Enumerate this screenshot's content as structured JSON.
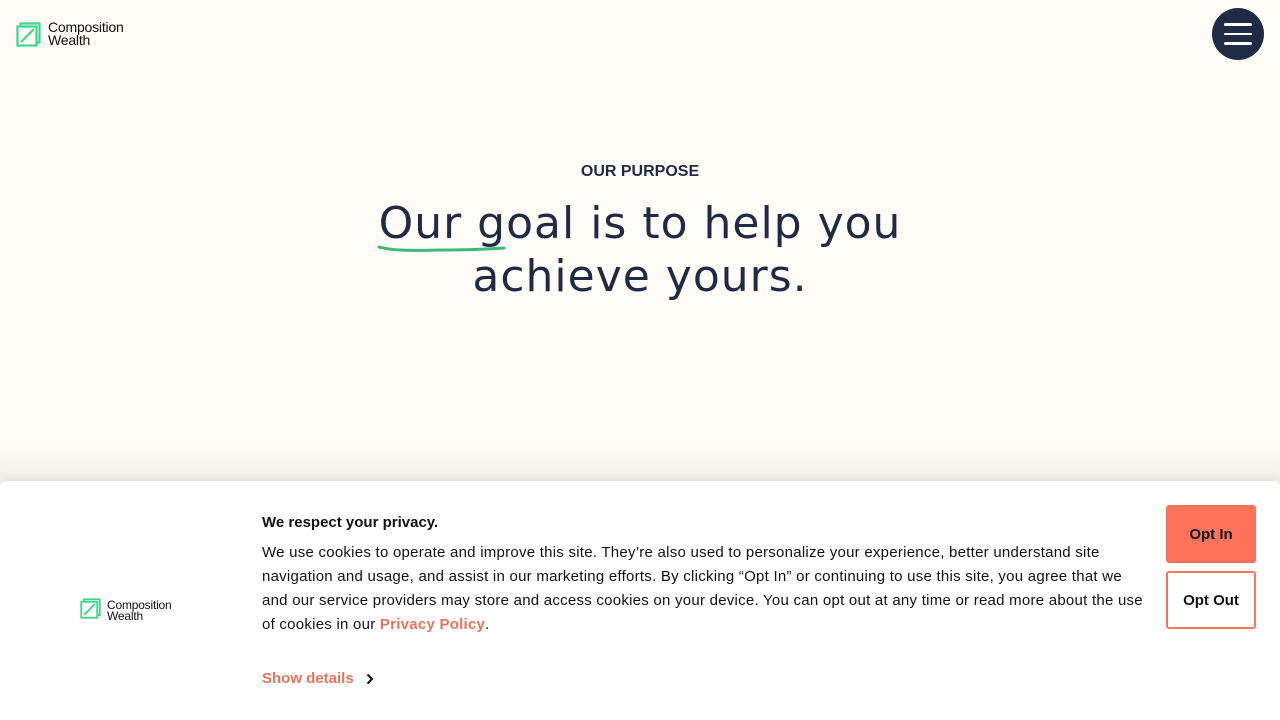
{
  "header": {
    "logo": {
      "line1": "Composition",
      "line2": "Wealth",
      "icon": "composition-wealth-logo-icon",
      "color": "#3dd68c"
    },
    "menu_button": {
      "icon": "hamburger-menu-icon",
      "background": "#1f2a44"
    }
  },
  "hero": {
    "eyebrow": "OUR PURPOSE",
    "headline": {
      "underlined": "Our goal",
      "rest_line1": " is to help you",
      "line2": "achieve yours."
    },
    "underline_color": "#3cba7a"
  },
  "cookie_banner": {
    "logo": {
      "line1": "Composition",
      "line2": "Wealth"
    },
    "title": "We respect your privacy.",
    "body": "We use cookies to operate and improve this site. They’re also used to personalize your experience, better understand site navigation and usage, and assist in our marketing efforts. By clicking “Opt In” or continuing to use this site, you agree that we and our service providers may store and access cookies on your device. You can opt out at any time or read more about the use of cookies in our ",
    "policy_link": "Privacy Policy",
    "body_end": ".",
    "show_details": "Show details",
    "opt_in": "Opt In",
    "opt_out": "Opt Out",
    "accent_color": "#ff735b"
  }
}
